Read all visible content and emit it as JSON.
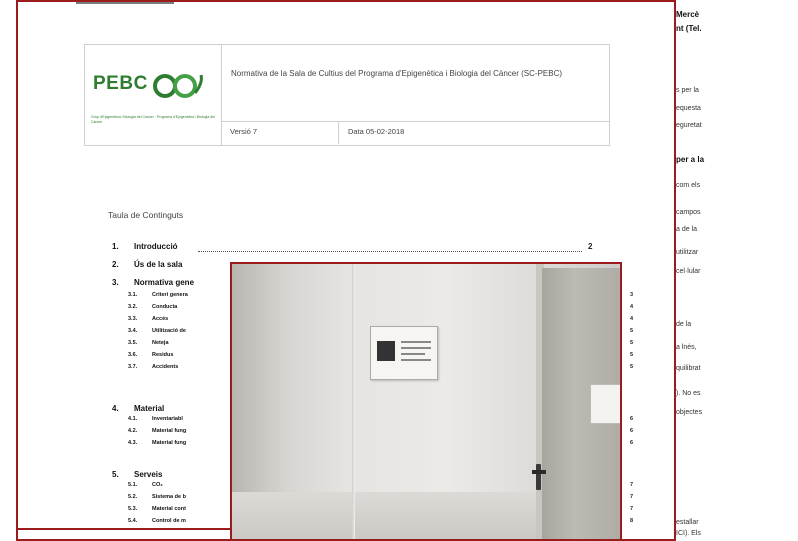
{
  "back_page": {
    "lines": [
      {
        "text": "Mercè",
        "bold": true
      },
      {
        "text": "nt (Tel.",
        "bold": true
      },
      {
        "text": "s per la",
        "bold": false
      },
      {
        "text": "equesta",
        "bold": false
      },
      {
        "text": "eguretat",
        "bold": false
      },
      {
        "text": "per a la",
        "bold": true
      },
      {
        "text": "com els",
        "bold": false
      },
      {
        "text": "campos",
        "bold": false
      },
      {
        "text": "a de la",
        "bold": false
      },
      {
        "text": "utilitzar",
        "bold": false
      },
      {
        "text": "cel·lular",
        "bold": false
      },
      {
        "text": "de la",
        "bold": false
      },
      {
        "text": "a lnés,",
        "bold": false
      },
      {
        "text": "quilibrat",
        "bold": false
      },
      {
        "text": "). No es",
        "bold": false
      },
      {
        "text": "objectes",
        "bold": false
      },
      {
        "text": "estallar",
        "bold": false
      },
      {
        "text": "ICI). Els",
        "bold": false
      }
    ]
  },
  "header": {
    "logo_text": "PEBC",
    "logo_subtitle": "Grup d'Epigenètica i Biologia del Càncer · Programa d'Epigenètica i Biologia del Càncer",
    "title": "Normativa de la Sala de Cultius del Programa d'Epigenètica i Biologia del Càncer (SC-PEBC)",
    "version": "Versió 7",
    "date": "Data 05-02-2018"
  },
  "toc": {
    "title": "Taula de Continguts",
    "items": [
      {
        "num": "1.",
        "label": "Introducció",
        "page": "2"
      },
      {
        "num": "2.",
        "label": "Ús de la sala"
      },
      {
        "num": "3.",
        "label": "Normativa gene"
      },
      {
        "num": "4.",
        "label": "Material"
      },
      {
        "num": "5.",
        "label": "Serveis"
      }
    ],
    "sub_items": [
      {
        "num": "3.1.",
        "label": "Criteri genera",
        "page": "3"
      },
      {
        "num": "3.2.",
        "label": "Conducta",
        "page": "4"
      },
      {
        "num": "3.3.",
        "label": "Accés",
        "page": "4"
      },
      {
        "num": "3.4.",
        "label": "Utilització de",
        "page": "5"
      },
      {
        "num": "3.5.",
        "label": "Neteja",
        "page": "5"
      },
      {
        "num": "3.6.",
        "label": "Residus",
        "page": "5"
      },
      {
        "num": "3.7.",
        "label": "Accidents",
        "page": "5"
      },
      {
        "num": "4.1.",
        "label": "Inventariabl",
        "page": "6"
      },
      {
        "num": "4.2.",
        "label": "Material fung",
        "page": "6"
      },
      {
        "num": "4.3.",
        "label": "Material fung",
        "page": "6"
      },
      {
        "num": "5.1.",
        "label": "CO₂",
        "page": "7"
      },
      {
        "num": "5.2.",
        "label": "Sistema de b",
        "page": "7"
      },
      {
        "num": "5.3.",
        "label": "Material cont",
        "page": "7"
      },
      {
        "num": "5.4.",
        "label": "Control de m",
        "page": "8"
      }
    ]
  },
  "colors": {
    "frame": "#9b1c1c",
    "brand_green": "#2e7d32"
  }
}
